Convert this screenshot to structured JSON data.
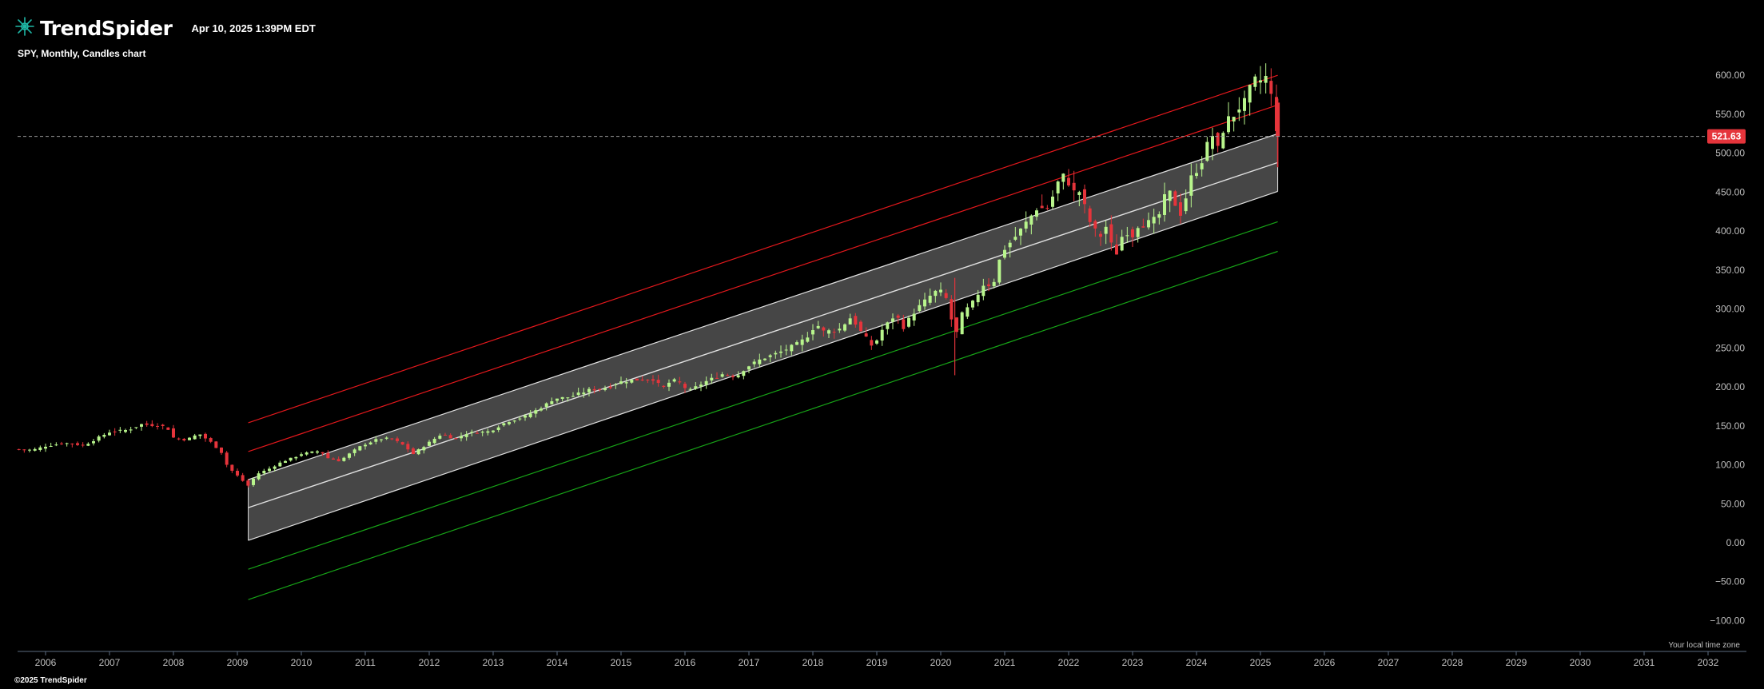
{
  "app": {
    "brand": "TrendSpider",
    "timestamp": "Apr 10, 2025 1:39PM EDT",
    "subtitle": "SPY, Monthly, Candles chart",
    "copyright": "©2025 TrendSpider",
    "timezone_note": "Your local time zone",
    "current_price_label": "521.63"
  },
  "colors": {
    "background": "#000000",
    "up_candle": "#b8f58c",
    "down_candle": "#e5343b",
    "red_band": "#e3181c",
    "green_band": "#17a317",
    "channel_fill": "#4a4a4a",
    "channel_edge": "#e0e0e0",
    "price_tag": "#e5343b",
    "axis_text": "#bfbfbf"
  },
  "chart_data": {
    "type": "candlestick",
    "symbol": "SPY",
    "interval": "Monthly",
    "y_ticks": [
      "600.00",
      "550.00",
      "500.00",
      "450.00",
      "400.00",
      "350.00",
      "300.00",
      "250.00",
      "200.00",
      "150.00",
      "100.00",
      "50.00",
      "0.00",
      "−50.00",
      "−100.00"
    ],
    "y_tick_values": [
      600,
      550,
      500,
      450,
      400,
      350,
      300,
      250,
      200,
      150,
      100,
      50,
      0,
      -50,
      -100
    ],
    "x_ticks": [
      "2006",
      "2007",
      "2008",
      "2009",
      "2010",
      "2011",
      "2012",
      "2013",
      "2014",
      "2015",
      "2016",
      "2017",
      "2018",
      "2019",
      "2020",
      "2021",
      "2022",
      "2023",
      "2024",
      "2025",
      "2026",
      "2027",
      "2028",
      "2029",
      "2030",
      "2031",
      "2032"
    ],
    "x_tick_values": [
      2006,
      2007,
      2008,
      2009,
      2010,
      2011,
      2012,
      2013,
      2014,
      2015,
      2016,
      2017,
      2018,
      2019,
      2020,
      2021,
      2022,
      2023,
      2024,
      2025,
      2026,
      2027,
      2028,
      2029,
      2030,
      2031,
      2032
    ],
    "x_range": [
      2005.55,
      2032.5
    ],
    "y_range": [
      -125,
      630
    ],
    "current_price": 521.63,
    "regression_channel": {
      "start_year": 2009.17,
      "end_year": 2025.27,
      "middle": [
        45,
        488
      ],
      "inner_upper": [
        81,
        525
      ],
      "inner_lower": [
        3,
        451
      ],
      "upper1": [
        117,
        562
      ],
      "upper2": [
        154,
        600
      ],
      "lower1": [
        -34,
        412
      ],
      "lower2": [
        -73,
        374
      ]
    },
    "monthly_close_points": [
      [
        2005.5,
        120
      ],
      [
        2005.8,
        119
      ],
      [
        2006.0,
        124
      ],
      [
        2006.3,
        128
      ],
      [
        2006.6,
        125
      ],
      [
        2006.9,
        138
      ],
      [
        2007.0,
        142
      ],
      [
        2007.3,
        145
      ],
      [
        2007.5,
        152
      ],
      [
        2007.8,
        150
      ],
      [
        2007.9,
        148
      ],
      [
        2008.0,
        135
      ],
      [
        2008.2,
        132
      ],
      [
        2008.4,
        140
      ],
      [
        2008.6,
        128
      ],
      [
        2008.75,
        116
      ],
      [
        2008.85,
        97
      ],
      [
        2008.95,
        90
      ],
      [
        2009.05,
        82
      ],
      [
        2009.17,
        73
      ],
      [
        2009.3,
        88
      ],
      [
        2009.5,
        95
      ],
      [
        2009.7,
        104
      ],
      [
        2009.9,
        110
      ],
      [
        2010.0,
        114
      ],
      [
        2010.3,
        118
      ],
      [
        2010.4,
        109
      ],
      [
        2010.6,
        105
      ],
      [
        2010.8,
        117
      ],
      [
        2010.95,
        125
      ],
      [
        2011.2,
        133
      ],
      [
        2011.4,
        134
      ],
      [
        2011.6,
        125
      ],
      [
        2011.75,
        114
      ],
      [
        2011.95,
        126
      ],
      [
        2012.2,
        140
      ],
      [
        2012.4,
        133
      ],
      [
        2012.6,
        141
      ],
      [
        2012.8,
        142
      ],
      [
        2012.95,
        143
      ],
      [
        2013.2,
        155
      ],
      [
        2013.5,
        162
      ],
      [
        2013.8,
        176
      ],
      [
        2013.95,
        185
      ],
      [
        2014.2,
        187
      ],
      [
        2014.5,
        196
      ],
      [
        2014.8,
        199
      ],
      [
        2014.95,
        206
      ],
      [
        2015.2,
        209
      ],
      [
        2015.5,
        210
      ],
      [
        2015.65,
        198
      ],
      [
        2015.8,
        209
      ],
      [
        2015.95,
        204
      ],
      [
        2016.05,
        194
      ],
      [
        2016.3,
        206
      ],
      [
        2016.6,
        217
      ],
      [
        2016.8,
        213
      ],
      [
        2016.95,
        225
      ],
      [
        2017.2,
        236
      ],
      [
        2017.5,
        245
      ],
      [
        2017.8,
        257
      ],
      [
        2017.95,
        268
      ],
      [
        2018.05,
        282
      ],
      [
        2018.15,
        271
      ],
      [
        2018.4,
        273
      ],
      [
        2018.6,
        290
      ],
      [
        2018.75,
        271
      ],
      [
        2018.95,
        250
      ],
      [
        2019.05,
        270
      ],
      [
        2019.3,
        294
      ],
      [
        2019.4,
        275
      ],
      [
        2019.6,
        298
      ],
      [
        2019.9,
        322
      ],
      [
        2020.05,
        322
      ],
      [
        2020.15,
        296
      ],
      [
        2020.22,
        257
      ],
      [
        2020.3,
        290
      ],
      [
        2020.5,
        308
      ],
      [
        2020.7,
        336
      ],
      [
        2020.8,
        326
      ],
      [
        2020.95,
        373
      ],
      [
        2021.2,
        396
      ],
      [
        2021.5,
        429
      ],
      [
        2021.7,
        430
      ],
      [
        2021.8,
        459
      ],
      [
        2021.95,
        474
      ],
      [
        2022.05,
        450
      ],
      [
        2022.2,
        451
      ],
      [
        2022.3,
        412
      ],
      [
        2022.4,
        412
      ],
      [
        2022.45,
        377
      ],
      [
        2022.55,
        411
      ],
      [
        2022.65,
        395
      ],
      [
        2022.7,
        358
      ],
      [
        2022.8,
        386
      ],
      [
        2022.9,
        407
      ],
      [
        2022.95,
        382
      ],
      [
        2023.05,
        407
      ],
      [
        2023.2,
        409
      ],
      [
        2023.4,
        417
      ],
      [
        2023.5,
        443
      ],
      [
        2023.6,
        450
      ],
      [
        2023.7,
        427
      ],
      [
        2023.8,
        418
      ],
      [
        2023.85,
        456
      ],
      [
        2023.95,
        475
      ],
      [
        2024.05,
        482
      ],
      [
        2024.15,
        508
      ],
      [
        2024.25,
        523
      ],
      [
        2024.32,
        501
      ],
      [
        2024.4,
        527
      ],
      [
        2024.5,
        544
      ],
      [
        2024.6,
        550
      ],
      [
        2024.7,
        563
      ],
      [
        2024.8,
        568
      ],
      [
        2024.88,
        602
      ],
      [
        2024.95,
        586
      ],
      [
        2025.05,
        601
      ],
      [
        2025.12,
        594
      ],
      [
        2025.2,
        559
      ],
      [
        2025.27,
        521.63
      ]
    ]
  }
}
